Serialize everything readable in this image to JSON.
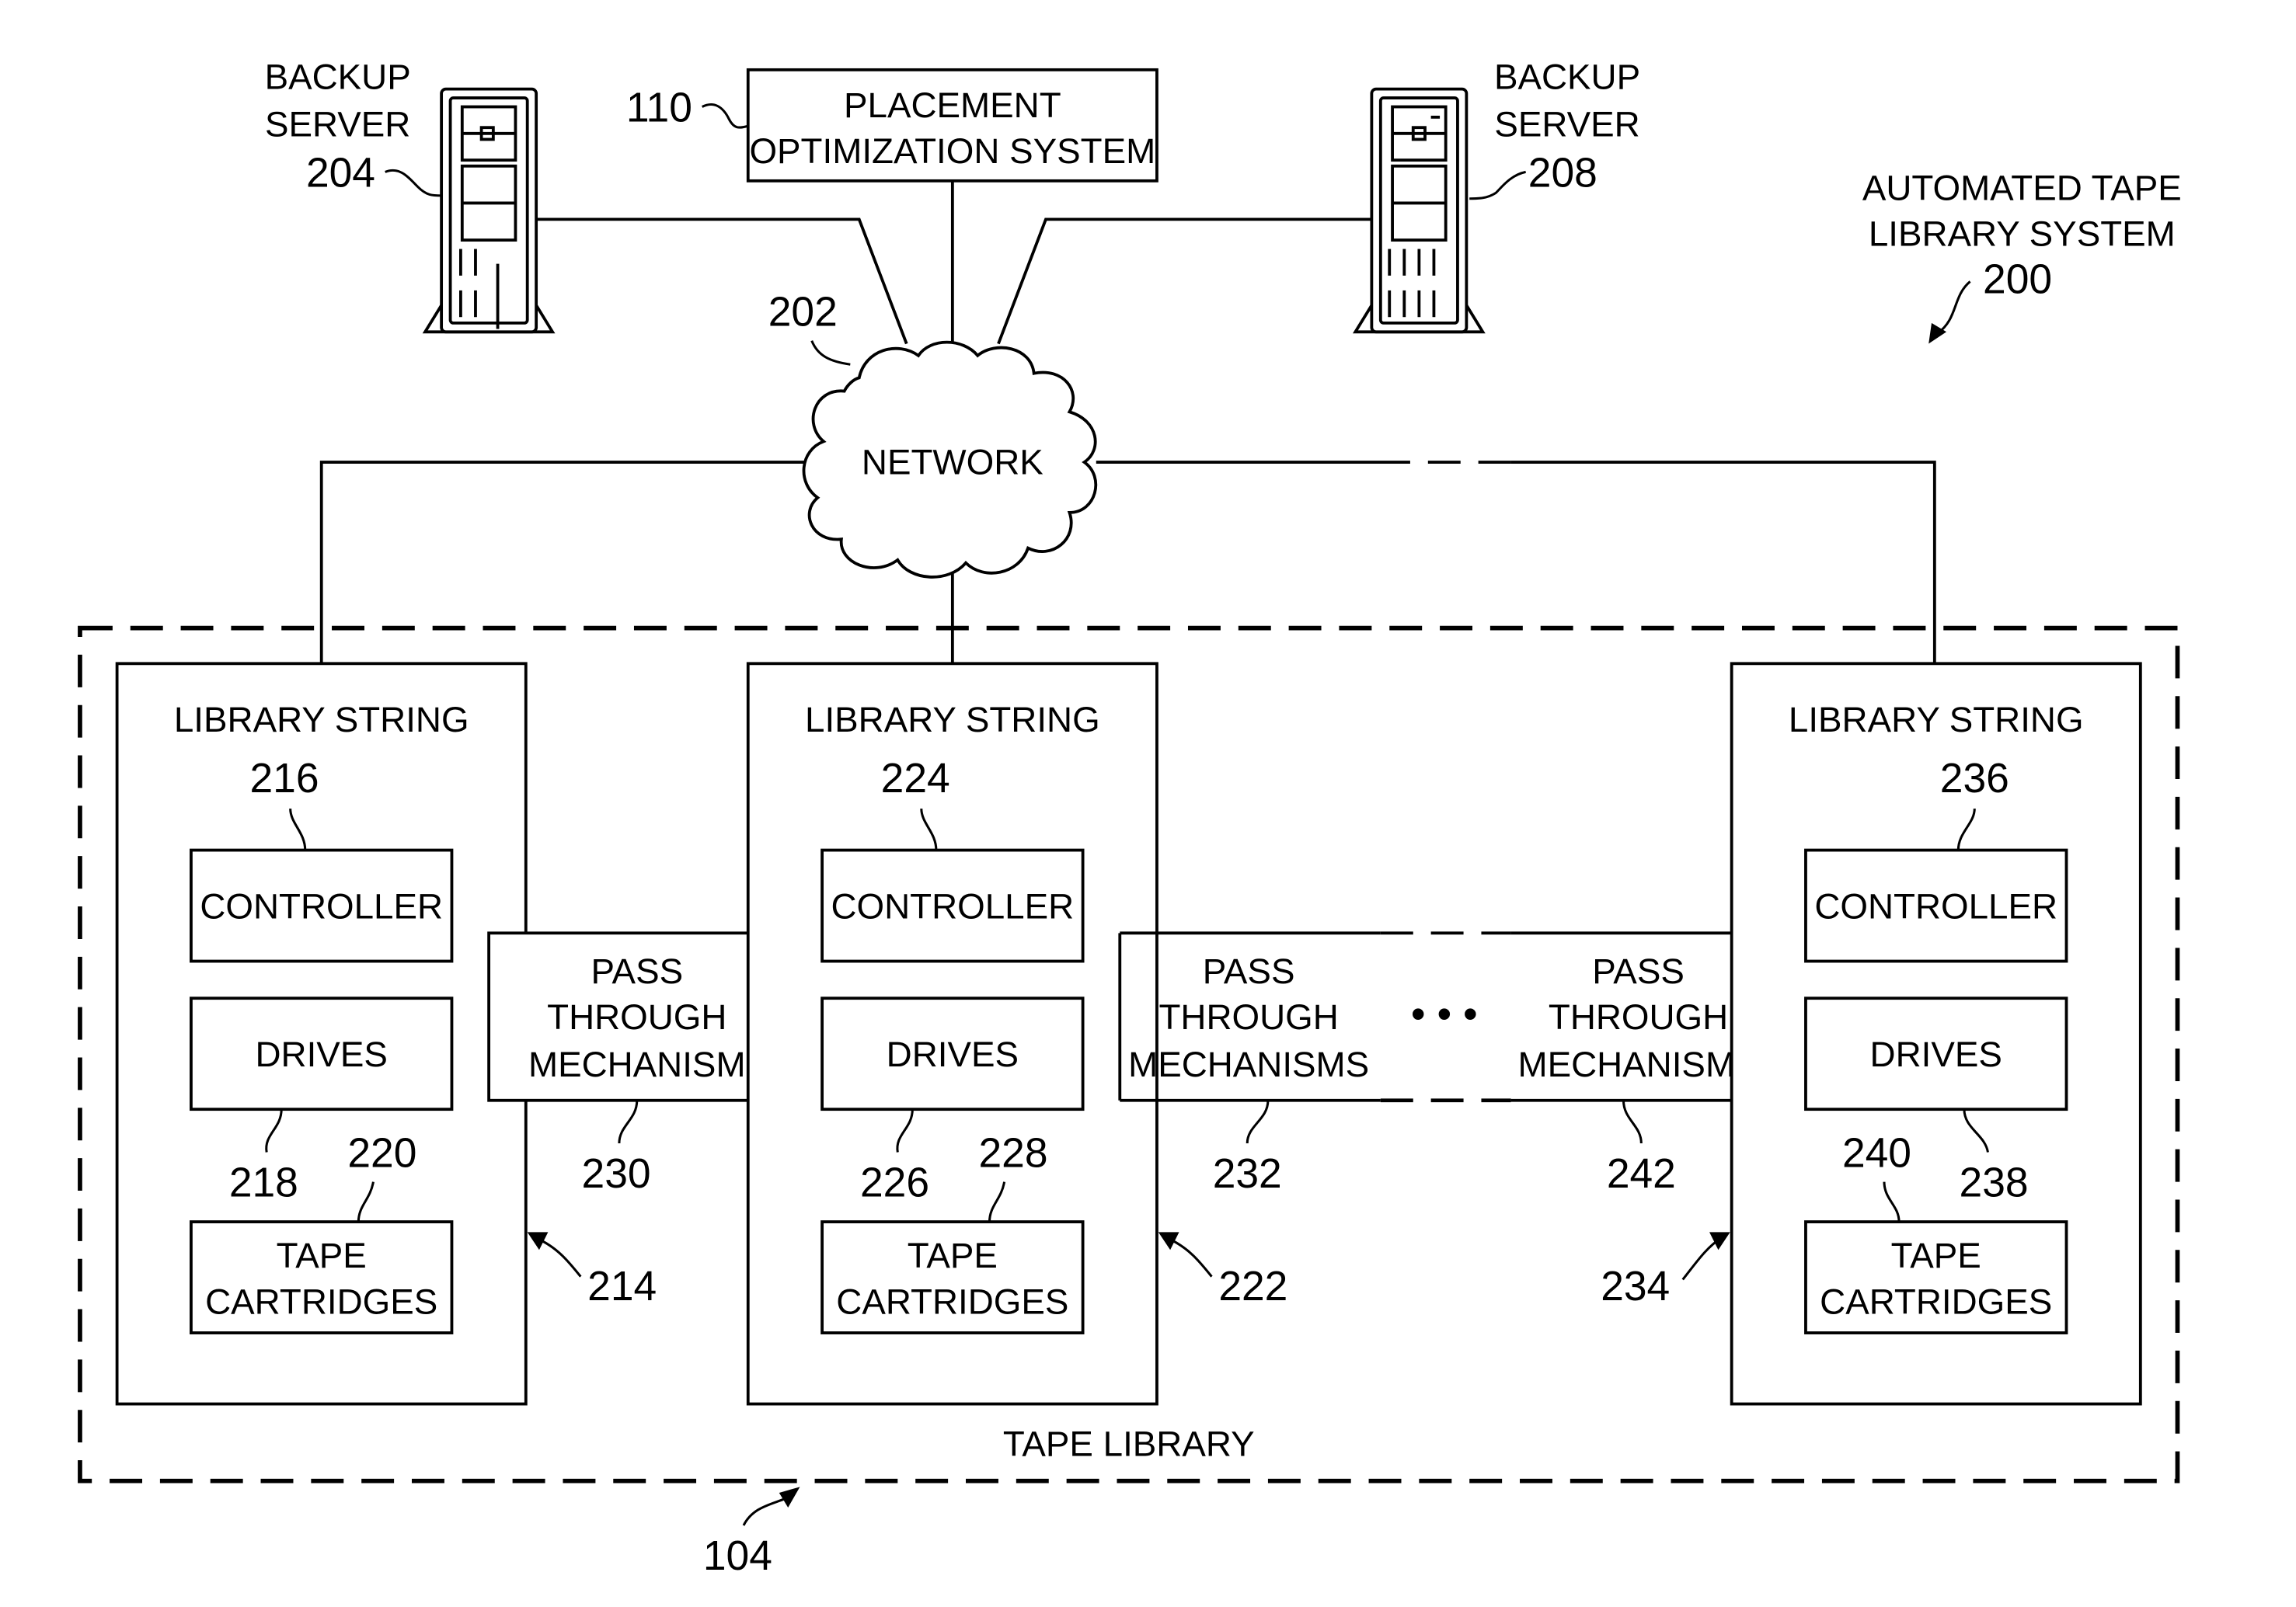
{
  "title": "AUTOMATED TAPE LIBRARY SYSTEM",
  "system_ref": "200",
  "placement_system": {
    "line1": "PLACEMENT",
    "line2": "OPTIMIZATION SYSTEM",
    "ref": "110"
  },
  "network": {
    "label": "NETWORK",
    "ref": "202"
  },
  "backup_servers": [
    {
      "line1": "BACKUP",
      "line2": "SERVER",
      "ref": "204"
    },
    {
      "line1": "BACKUP",
      "line2": "SERVER",
      "ref": "208"
    }
  ],
  "tape_library": {
    "label": "TAPE LIBRARY",
    "ref": "104"
  },
  "library_strings": [
    {
      "label": "LIBRARY STRING",
      "ref": "216",
      "controller": "CONTROLLER",
      "drives": "DRIVES",
      "drives_ref": "218",
      "tape_line1": "TAPE",
      "tape_line2": "CARTRIDGES",
      "tape_ref": "220",
      "string_ref": "214"
    },
    {
      "label": "LIBRARY STRING",
      "ref": "224",
      "controller": "CONTROLLER",
      "drives": "DRIVES",
      "drives_ref": "226",
      "tape_line1": "TAPE",
      "tape_line2": "CARTRIDGES",
      "tape_ref": "228",
      "string_ref": "222"
    },
    {
      "label": "LIBRARY STRING",
      "ref": "236",
      "controller": "CONTROLLER",
      "drives": "DRIVES",
      "drives_ref": "238",
      "tape_line1": "TAPE",
      "tape_line2": "CARTRIDGES",
      "tape_ref": "240",
      "string_ref": "234"
    }
  ],
  "pass_through": [
    {
      "line1": "PASS",
      "line2": "THROUGH",
      "line3": "MECHANISM",
      "ref": "230"
    },
    {
      "line1": "PASS",
      "line2": "THROUGH",
      "line3": "MECHANISMS",
      "ref": "232"
    },
    {
      "line1": "PASS",
      "line2": "THROUGH",
      "line3": "MECHANISMS",
      "ref": "242"
    }
  ],
  "ellipsis": "• • •"
}
